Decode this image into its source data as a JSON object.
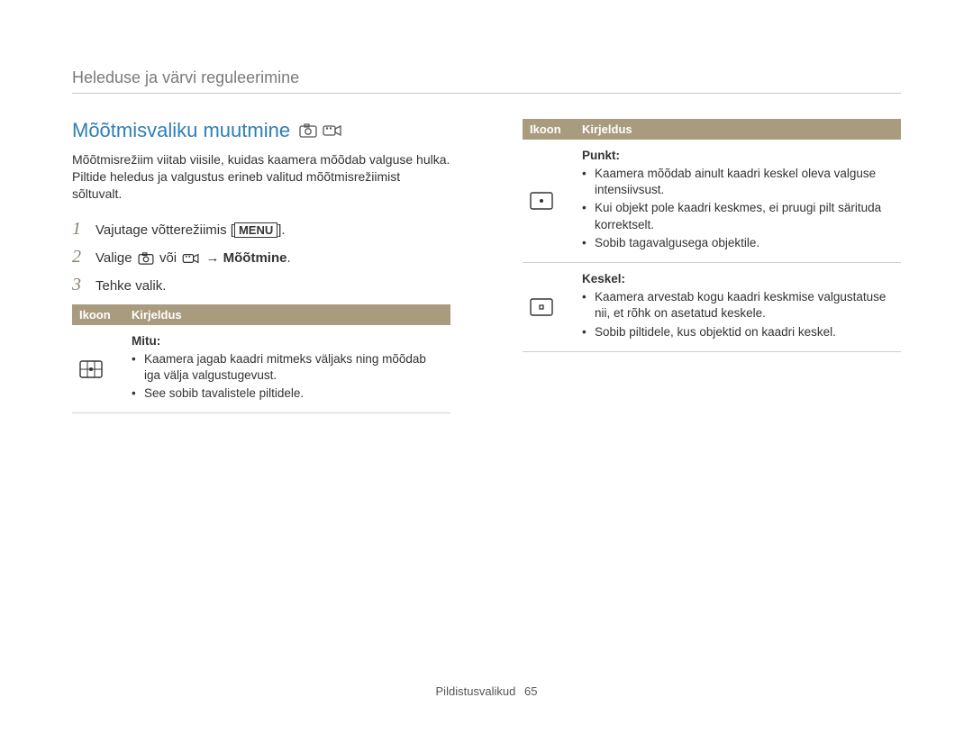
{
  "header": "Heleduse ja värvi reguleerimine",
  "section_title": "Mõõtmisvaliku muutmine",
  "intro": "Mõõtmisrežiim viitab viisile, kuidas kaamera mõõdab valguse hulka. Piltide heledus ja valgustus erineb valitud mõõtmisrežiimist sõltuvalt.",
  "steps": {
    "s1": {
      "num": "1",
      "prefix": "Vajutage võtterežiimis [",
      "menu": "MENU",
      "suffix": "]."
    },
    "s2": {
      "num": "2",
      "prefix": "Valige ",
      "mid": " või ",
      "arrow": " → ",
      "target": "Mõõtmine",
      "suffix": "."
    },
    "s3": {
      "num": "3",
      "text": "Tehke valik."
    }
  },
  "table_headers": {
    "icon": "Ikoon",
    "desc": "Kirjeldus"
  },
  "left_rows": [
    {
      "head": "Mitu:",
      "bullets": [
        "Kaamera jagab kaadri mitmeks väljaks ning mõõdab iga välja valgustugevust.",
        "See sobib tavalistele piltidele."
      ]
    }
  ],
  "right_rows": [
    {
      "head": "Punkt:",
      "bullets": [
        "Kaamera mõõdab ainult kaadri keskel oleva valguse intensiivsust.",
        "Kui objekt pole kaadri keskmes, ei pruugi pilt särituda korrektselt.",
        "Sobib tagavalgusega objektile."
      ]
    },
    {
      "head": "Keskel:",
      "bullets": [
        "Kaamera arvestab kogu kaadri keskmise valgustatuse nii, et rõhk on asetatud keskele.",
        "Sobib piltidele, kus objektid on kaadri keskel."
      ]
    }
  ],
  "footer": {
    "label": "Pildistusvalikud",
    "page": "65"
  },
  "icons": {
    "camera": "camera-icon",
    "video": "video-camera-icon",
    "multi": "multi-metering-icon",
    "spot": "spot-metering-icon",
    "center": "center-metering-icon"
  }
}
